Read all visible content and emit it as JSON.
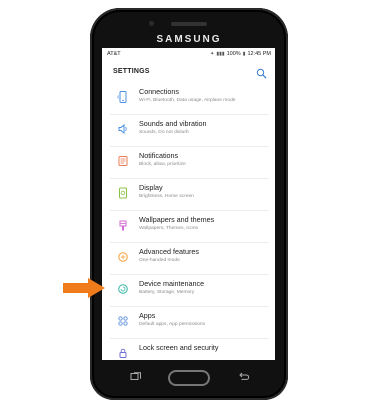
{
  "device": {
    "brand": "SAMSUNG"
  },
  "statusbar": {
    "carrier": "AT&T",
    "battery": "100%",
    "time": "12:45 PM"
  },
  "appbar": {
    "title": "SETTINGS"
  },
  "settings_items": [
    {
      "label": "Connections",
      "sub": "Wi-Fi, Bluetooth, Data usage, Airplane mode",
      "icon": "connections-icon",
      "color": "#4a90e2"
    },
    {
      "label": "Sounds and vibration",
      "sub": "Sounds, Do not disturb",
      "icon": "sound-icon",
      "color": "#4a90e2"
    },
    {
      "label": "Notifications",
      "sub": "Block, allow, prioritize",
      "icon": "notifications-icon",
      "color": "#ef7d57"
    },
    {
      "label": "Display",
      "sub": "Brightness, Home screen",
      "icon": "display-icon",
      "color": "#8bc34a"
    },
    {
      "label": "Wallpapers and themes",
      "sub": "Wallpapers, Themes, Icons",
      "icon": "wallpapers-icon",
      "color": "#d46ad4"
    },
    {
      "label": "Advanced features",
      "sub": "One-handed mode",
      "icon": "advanced-features-icon",
      "color": "#f4a13b"
    },
    {
      "label": "Device maintenance",
      "sub": "Battery, Storage, Memory",
      "icon": "device-maintenance-icon",
      "color": "#38b7a5"
    },
    {
      "label": "Apps",
      "sub": "Default apps, App permissions",
      "icon": "apps-icon",
      "color": "#5c8fd8"
    },
    {
      "label": "Lock screen and security",
      "sub": "",
      "icon": "lock-icon",
      "color": "#6d6dd8"
    }
  ],
  "callout": {
    "color": "#ef7b1b"
  }
}
